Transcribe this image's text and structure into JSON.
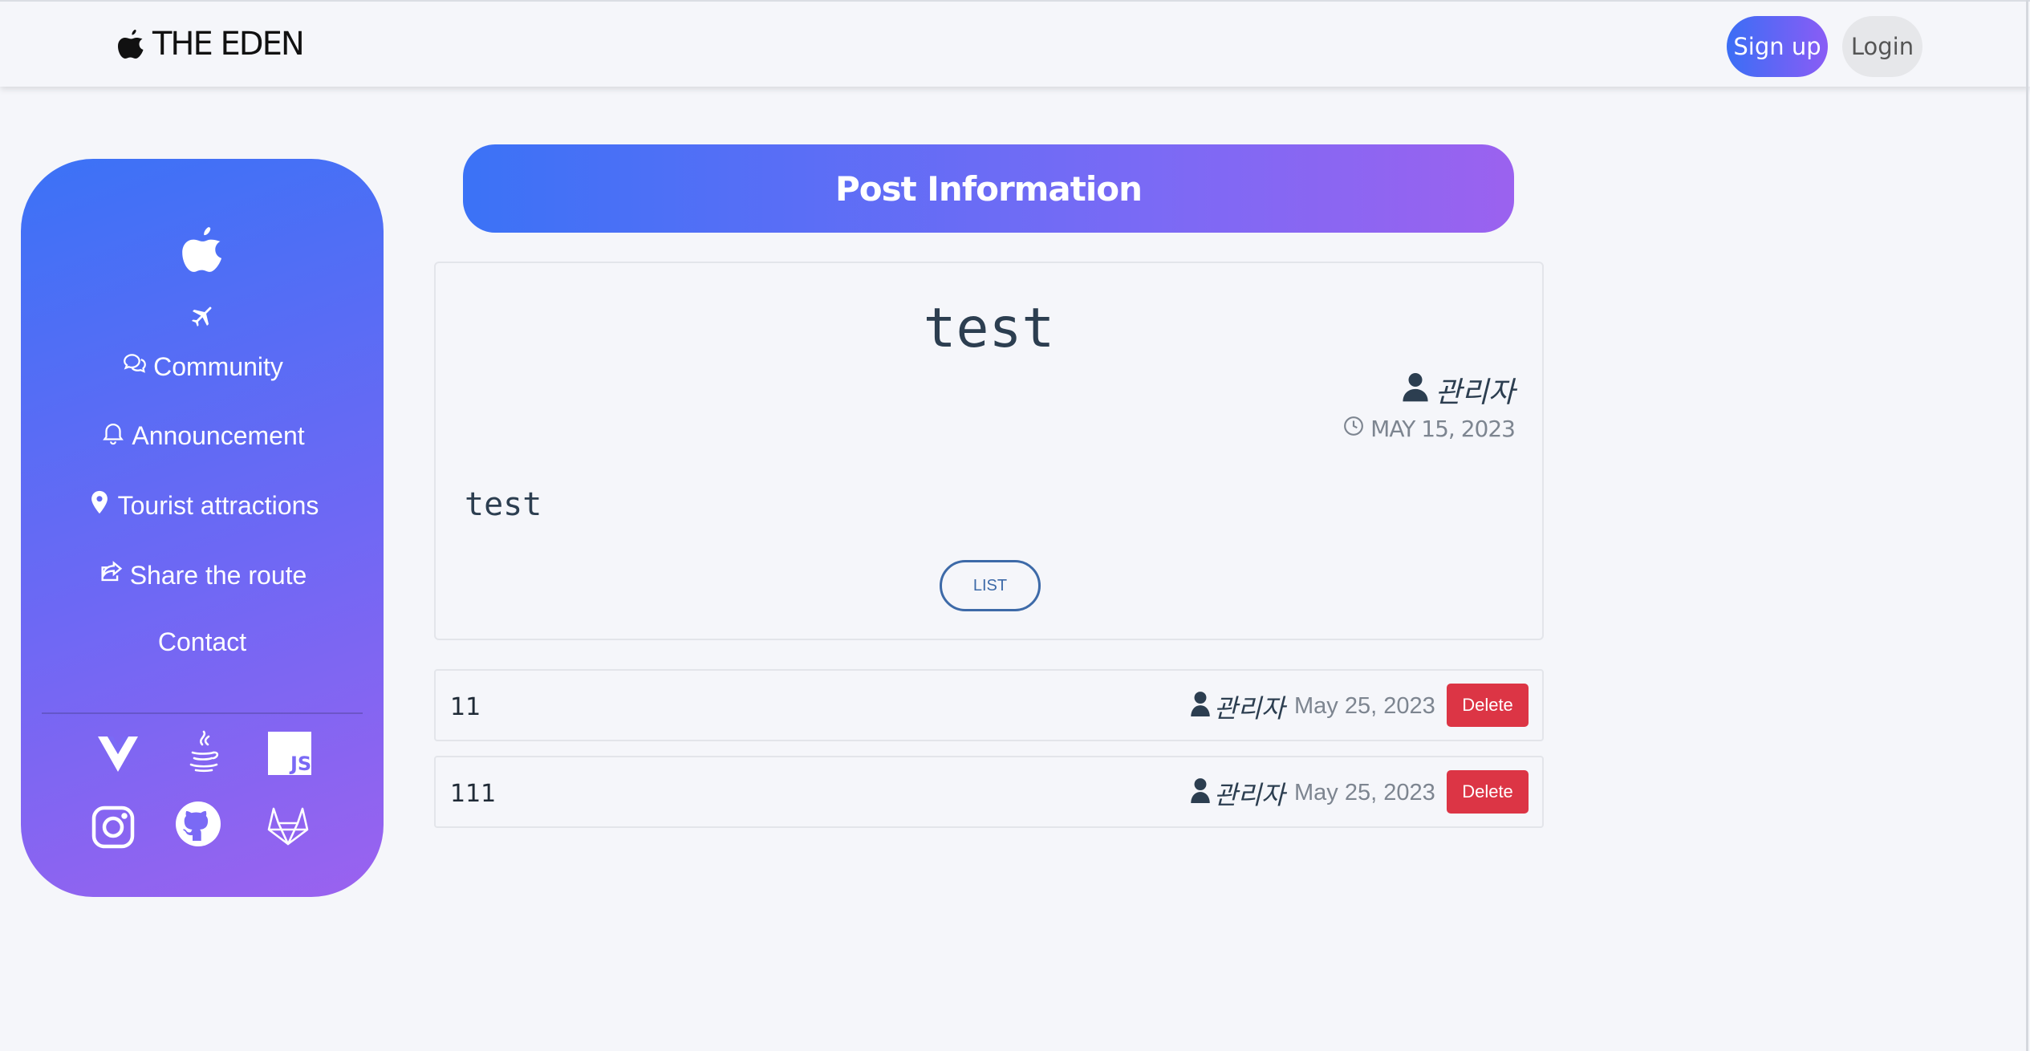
{
  "navbar": {
    "brand_text": "THE EDEN",
    "brand_icon": "apple-icon",
    "signup_label": "Sign up",
    "login_label": "Login"
  },
  "sidebar": {
    "logo_icon": "apple-icon",
    "plane_icon": "airplane-icon",
    "items": [
      {
        "label": "Community",
        "icon": "chat-bubbles-icon"
      },
      {
        "label": "Announcement",
        "icon": "bell-icon"
      },
      {
        "label": "Tourist attractions",
        "icon": "map-pin-icon"
      },
      {
        "label": "Share the route",
        "icon": "share-icon"
      },
      {
        "label": "Contact",
        "icon": ""
      }
    ],
    "tech_icons": [
      "vue-icon",
      "java-icon",
      "javascript-icon"
    ],
    "social_icons": [
      "instagram-icon",
      "github-icon",
      "gitlab-icon"
    ],
    "js_badge": "JS"
  },
  "banner": {
    "title": "Post Information"
  },
  "post": {
    "title": "test",
    "author": "관리자",
    "date": "MAY 15, 2023",
    "body": "test",
    "list_label": "LIST"
  },
  "comments": [
    {
      "text": "11",
      "author": "관리자",
      "date": "May 25, 2023",
      "delete_label": "Delete"
    },
    {
      "text": "111",
      "author": "관리자",
      "date": "May 25, 2023",
      "delete_label": "Delete"
    }
  ],
  "colors": {
    "accent_start": "#3b72f6",
    "accent_end": "#9b62ef",
    "danger": "#dc3545",
    "list_outline": "#3d6aa8"
  }
}
